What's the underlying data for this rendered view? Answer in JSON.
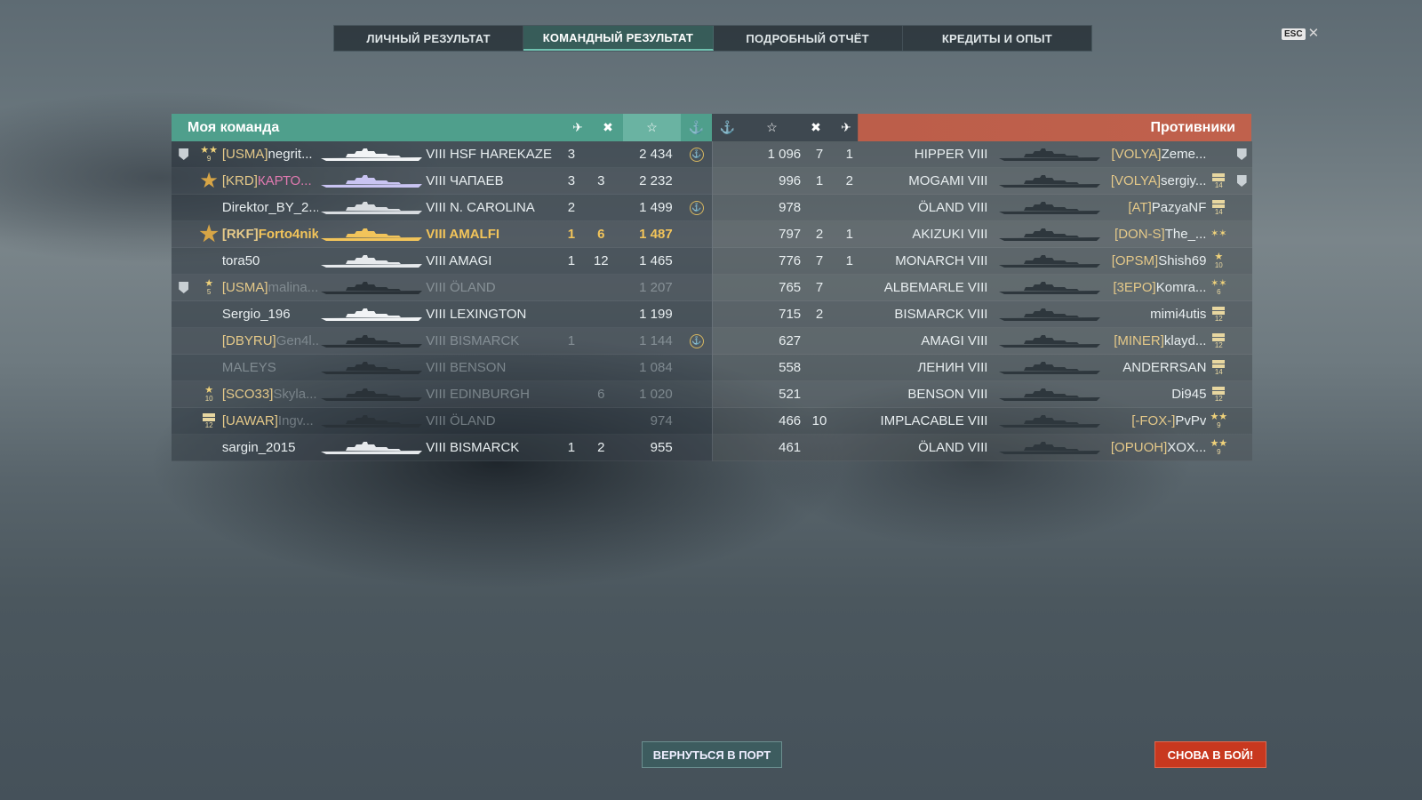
{
  "tabs": [
    "ЛИЧНЫЙ РЕЗУЛЬТАТ",
    "КОМАНДНЫЙ РЕЗУЛЬТАТ",
    "ПОДРОБНЫЙ ОТЧЁТ",
    "КРЕДИТЫ И ОПЫТ"
  ],
  "active_tab": 1,
  "esc": {
    "key": "ESC",
    "close": "✕"
  },
  "my_team": {
    "title": "Моя команда",
    "rows": [
      {
        "clan": "[USMA]",
        "name": "negrit...",
        "tier": "VIII",
        "ship": "HSF HAREKAZE",
        "a": "3",
        "b": "",
        "xp": "2 434",
        "crest": true,
        "badge": true,
        "rank": "9",
        "rank_kind": "stars2",
        "state": "alive",
        "ship_color": "#f2f4f6"
      },
      {
        "clan": "[KRD]",
        "name": "КАРТО...",
        "tier": "VIII",
        "ship": "ЧАПАЕВ",
        "a": "3",
        "b": "3",
        "xp": "2 232",
        "crest": false,
        "badge": false,
        "rank": "",
        "rank_kind": "big",
        "state": "alive",
        "name_color": "pink",
        "ship_color": "#c9c4f2"
      },
      {
        "clan": "",
        "name": "Direktor_BY_2...",
        "tier": "VIII",
        "ship": "N. CAROLINA",
        "a": "2",
        "b": "",
        "xp": "1 499",
        "crest": true,
        "badge": false,
        "rank": "",
        "rank_kind": "",
        "state": "alive",
        "ship_color": "#d8dce0"
      },
      {
        "clan": "[RKF]",
        "name": "Forto4nik",
        "tier": "VIII",
        "ship": "AMALFI",
        "a": "1",
        "b": "6",
        "xp": "1 487",
        "crest": false,
        "badge": false,
        "rank": "",
        "rank_kind": "big",
        "state": "me",
        "ship_color": "#f2c45a"
      },
      {
        "clan": "",
        "name": "tora50",
        "tier": "VIII",
        "ship": "AMAGI",
        "a": "1",
        "b": "12",
        "xp": "1 465",
        "crest": false,
        "badge": false,
        "rank": "",
        "rank_kind": "",
        "state": "alive",
        "ship_color": "#e6e9ec"
      },
      {
        "clan": "[USMA]",
        "name": "malina...",
        "tier": "VIII",
        "ship": "ÖLAND",
        "a": "",
        "b": "",
        "xp": "1 207",
        "crest": false,
        "badge": true,
        "rank": "5",
        "rank_kind": "star1",
        "state": "dead",
        "ship_color": "#2a3238"
      },
      {
        "clan": "",
        "name": "Sergio_196",
        "tier": "VIII",
        "ship": "LEXINGTON",
        "a": "",
        "b": "",
        "xp": "1 199",
        "crest": false,
        "badge": false,
        "rank": "",
        "rank_kind": "",
        "state": "alive",
        "ship_color": "#f2f4f6"
      },
      {
        "clan": "[DBYRU]",
        "name": "Gen4l...",
        "tier": "VIII",
        "ship": "BISMARCK",
        "a": "1",
        "b": "",
        "xp": "1 144",
        "crest": true,
        "badge": false,
        "rank": "",
        "rank_kind": "",
        "state": "dead",
        "ship_color": "#2a3238"
      },
      {
        "clan": "",
        "name": "MALEYS",
        "tier": "VIII",
        "ship": "BENSON",
        "a": "",
        "b": "",
        "xp": "1 084",
        "crest": false,
        "badge": false,
        "rank": "",
        "rank_kind": "",
        "state": "dead",
        "ship_color": "#2a3238"
      },
      {
        "clan": "[SCO33]",
        "name": "Skyla...",
        "tier": "VIII",
        "ship": "EDINBURGH",
        "a": "",
        "b": "6",
        "xp": "1 020",
        "crest": false,
        "badge": false,
        "rank": "10",
        "rank_kind": "star1",
        "state": "dead",
        "ship_color": "#2a3238"
      },
      {
        "clan": "[UAWAR]",
        "name": "Ingv...",
        "tier": "VIII",
        "ship": "ÖLAND",
        "a": "",
        "b": "",
        "xp": "974",
        "crest": false,
        "badge": false,
        "rank": "12",
        "rank_kind": "bar",
        "state": "dead",
        "ship_color": "#2a3238"
      },
      {
        "clan": "",
        "name": "sargin_2015",
        "tier": "VIII",
        "ship": "BISMARCK",
        "a": "1",
        "b": "2",
        "xp": "955",
        "crest": false,
        "badge": false,
        "rank": "",
        "rank_kind": "",
        "state": "alive",
        "ship_color": "#e6e9ec"
      }
    ]
  },
  "enemy_team": {
    "title": "Противники",
    "rows": [
      {
        "xp": "1 096",
        "b": "7",
        "a": "1",
        "ship": "HIPPER",
        "tier": "VIII",
        "clan": "[VOLYA]",
        "name": "Zeme...",
        "rank": "",
        "rank_kind": "",
        "badge": true
      },
      {
        "xp": "996",
        "b": "1",
        "a": "2",
        "ship": "MOGAMI",
        "tier": "VIII",
        "clan": "[VOLYA]",
        "name": "sergiy...",
        "rank": "14",
        "rank_kind": "bar",
        "badge": true
      },
      {
        "xp": "978",
        "b": "",
        "a": "",
        "ship": "ÖLAND",
        "tier": "VIII",
        "clan": "[AT]",
        "name": "PazyaNF",
        "rank": "14",
        "rank_kind": "bar",
        "badge": false
      },
      {
        "xp": "797",
        "b": "2",
        "a": "1",
        "ship": "AKIZUKI",
        "tier": "VIII",
        "clan": "[DON-S]",
        "name": "The_...",
        "rank": "",
        "rank_kind": "stars3",
        "badge": false
      },
      {
        "xp": "776",
        "b": "7",
        "a": "1",
        "ship": "MONARCH",
        "tier": "VIII",
        "clan": "[OPSM]",
        "name": "Shish69",
        "rank": "10",
        "rank_kind": "star1",
        "badge": false
      },
      {
        "xp": "765",
        "b": "7",
        "a": "",
        "ship": "ALBEMARLE",
        "tier": "VIII",
        "clan": "[3EPO]",
        "name": "Komra...",
        "rank": "6",
        "rank_kind": "stars3",
        "badge": false
      },
      {
        "xp": "715",
        "b": "2",
        "a": "",
        "ship": "BISMARCK",
        "tier": "VIII",
        "clan": "",
        "name": "mimi4utis",
        "rank": "12",
        "rank_kind": "bar",
        "badge": false
      },
      {
        "xp": "627",
        "b": "",
        "a": "",
        "ship": "AMAGI",
        "tier": "VIII",
        "clan": "[MINER]",
        "name": "klayd...",
        "rank": "12",
        "rank_kind": "bar",
        "badge": false
      },
      {
        "xp": "558",
        "b": "",
        "a": "",
        "ship": "ЛЕНИН",
        "tier": "VIII",
        "clan": "",
        "name": "ANDERRSAN",
        "rank": "14",
        "rank_kind": "bar",
        "badge": false
      },
      {
        "xp": "521",
        "b": "",
        "a": "",
        "ship": "BENSON",
        "tier": "VIII",
        "clan": "",
        "name": "Di945",
        "rank": "12",
        "rank_kind": "bar",
        "badge": false
      },
      {
        "xp": "466",
        "b": "10",
        "a": "",
        "ship": "IMPLACABLE",
        "tier": "VIII",
        "clan": "[-FOX-]",
        "name": "PvPv",
        "rank": "9",
        "rank_kind": "stars2",
        "badge": false
      },
      {
        "xp": "461",
        "b": "",
        "a": "",
        "ship": "ÖLAND",
        "tier": "VIII",
        "clan": "[OPUOH]",
        "name": "XOX...",
        "rank": "9",
        "rank_kind": "stars2",
        "badge": false
      }
    ]
  },
  "header_icons": {
    "planes": "✈",
    "kills": "✖",
    "xp": "☆",
    "base": "⚓"
  },
  "buttons": {
    "port": "ВЕРНУТЬСЯ В ПОРТ",
    "battle": "СНОВА В БОЙ!"
  }
}
